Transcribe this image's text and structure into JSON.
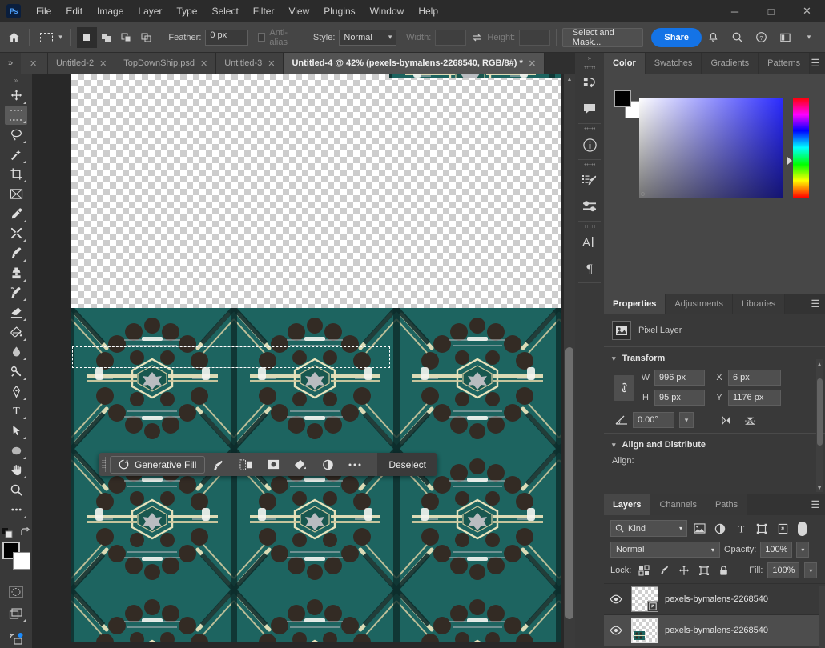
{
  "app": {
    "name": "Adobe Photoshop",
    "logo_text": "Ps"
  },
  "menubar": {
    "items": [
      "File",
      "Edit",
      "Image",
      "Layer",
      "Type",
      "Select",
      "Filter",
      "View",
      "Plugins",
      "Window",
      "Help"
    ]
  },
  "window_controls": {
    "minimize": "─",
    "maximize": "□",
    "close": "✕"
  },
  "options_bar": {
    "home_icon": "home-icon",
    "tool_icon": "rectangular-marquee-icon",
    "selection_modes": [
      "new-selection",
      "add-to-selection",
      "subtract-from-selection",
      "intersect-with-selection"
    ],
    "active_selection_mode": 0,
    "feather_label": "Feather:",
    "feather_value": "0 px",
    "antialias_label": "Anti-alias",
    "antialias_checked": false,
    "style_label": "Style:",
    "style_value": "Normal",
    "width_label": "Width:",
    "width_value": "",
    "height_label": "Height:",
    "height_value": "",
    "swap_icon": "swap-dimensions-icon",
    "select_and_mask": "Select and Mask...",
    "share": "Share",
    "right_icons": [
      "bell-icon",
      "search-icon",
      "help-icon",
      "workspace-icon",
      "chevron-down-icon"
    ]
  },
  "tabs": {
    "overflow_left": "»",
    "overflow_right": "»",
    "items": [
      {
        "label": "",
        "active": false,
        "clipped": true
      },
      {
        "label": "Untitled-2",
        "active": false,
        "clipped": false
      },
      {
        "label": "TopDownShip.psd",
        "active": false,
        "clipped": false
      },
      {
        "label": "Untitled-3",
        "active": false,
        "clipped": false
      },
      {
        "label": "Untitled-4 @ 42% (pexels-bymalens-2268540, RGB/8#) *",
        "active": true,
        "clipped": false
      }
    ],
    "close_glyph": "✕"
  },
  "toolbar": {
    "collapse_glyph": "»",
    "tools": [
      {
        "name": "move-tool",
        "has_flyout": true,
        "active": false
      },
      {
        "name": "rectangular-marquee-tool",
        "has_flyout": true,
        "active": true
      },
      {
        "name": "lasso-tool",
        "has_flyout": true,
        "active": false
      },
      {
        "name": "magic-wand-tool",
        "has_flyout": true,
        "active": false
      },
      {
        "name": "crop-tool",
        "has_flyout": true,
        "active": false
      },
      {
        "name": "frame-tool",
        "has_flyout": false,
        "active": false
      },
      {
        "name": "eyedropper-tool",
        "has_flyout": true,
        "active": false
      },
      {
        "name": "spot-healing-brush-tool",
        "has_flyout": true,
        "active": false
      },
      {
        "name": "brush-tool",
        "has_flyout": true,
        "active": false
      },
      {
        "name": "clone-stamp-tool",
        "has_flyout": true,
        "active": false
      },
      {
        "name": "history-brush-tool",
        "has_flyout": true,
        "active": false
      },
      {
        "name": "eraser-tool",
        "has_flyout": true,
        "active": false
      },
      {
        "name": "gradient-tool",
        "has_flyout": true,
        "active": false
      },
      {
        "name": "blur-tool",
        "has_flyout": true,
        "active": false
      },
      {
        "name": "dodge-tool",
        "has_flyout": true,
        "active": false
      },
      {
        "name": "pen-tool",
        "has_flyout": true,
        "active": false
      },
      {
        "name": "type-tool",
        "has_flyout": true,
        "active": false
      },
      {
        "name": "path-selection-tool",
        "has_flyout": true,
        "active": false
      },
      {
        "name": "ellipse-shape-tool",
        "has_flyout": true,
        "active": false
      },
      {
        "name": "hand-tool",
        "has_flyout": true,
        "active": false
      },
      {
        "name": "zoom-tool",
        "has_flyout": false,
        "active": false
      },
      {
        "name": "edit-toolbar-tool",
        "has_flyout": true,
        "active": false
      }
    ],
    "foreground_color": "#000000",
    "background_color": "#ffffff",
    "default_colors_icon": "default-colors-icon",
    "swap_colors_icon": "swap-colors-icon",
    "quick_mask_icon": "quick-mask-icon",
    "screen_mode_icon": "screen-mode-icon",
    "share_image_icon": "share-image-icon"
  },
  "canvas": {
    "zoom": "42%",
    "document_title": "Untitled-4",
    "selection": {
      "label": "marching-ants-selection"
    },
    "image_name": "pexels-bymalens-2268540",
    "palette": {
      "teal": "#1d6460",
      "dark_teal": "#0d3331",
      "cream": "#e7e2bb",
      "dark_brown": "#332b24",
      "light_gray": "#c8cdd0",
      "white_highlight": "#f4f6f2"
    }
  },
  "contextual_taskbar": {
    "grip": "drag-handle-icon",
    "generative_fill": "Generative Fill",
    "generative_fill_icon": "generative-fill-sparkle-icon",
    "icons": [
      "select-subject-icon",
      "select-and-mask-icon",
      "add-mask-icon",
      "adjustment-fill-icon",
      "adjustment-layer-icon",
      "more-options-icon"
    ],
    "deselect": "Deselect"
  },
  "icon_dock": {
    "collapse_glyph": "»",
    "items": [
      {
        "name": "history-icon"
      },
      {
        "name": "comments-icon"
      },
      {
        "name": "info-icon"
      },
      {
        "name": "brush-settings-icon"
      },
      {
        "name": "adjustments-sliders-icon"
      },
      {
        "name": "character-icon"
      },
      {
        "name": "paragraph-icon"
      }
    ]
  },
  "color_panel": {
    "tabs": [
      "Color",
      "Swatches",
      "Gradients",
      "Patterns"
    ],
    "active_tab": "Color",
    "menu_icon": "panel-menu-icon",
    "foreground": "#000000",
    "background": "#ffffff"
  },
  "properties_panel": {
    "tabs": [
      "Properties",
      "Adjustments",
      "Libraries"
    ],
    "active_tab": "Properties",
    "menu_icon": "panel-menu-icon",
    "layer_type_icon": "pixel-layer-icon",
    "layer_type": "Pixel Layer",
    "transform": {
      "title": "Transform",
      "link_icon": "link-aspect-ratio-icon",
      "w_label": "W",
      "w_value": "996 px",
      "h_label": "H",
      "h_value": "95 px",
      "x_label": "X",
      "x_value": "6 px",
      "y_label": "Y",
      "y_value": "1176 px",
      "angle_icon": "angle-icon",
      "angle_value": "0.00°",
      "flip_horizontal_icon": "flip-horizontal-icon",
      "flip_vertical_icon": "flip-vertical-icon"
    },
    "align": {
      "title": "Align and Distribute",
      "label": "Align:"
    }
  },
  "layers_panel": {
    "tabs": [
      "Layers",
      "Channels",
      "Paths"
    ],
    "active_tab": "Layers",
    "menu_icon": "panel-menu-icon",
    "filter": {
      "search_icon": "search-icon",
      "kind_label": "Kind",
      "filter_icons": [
        "filter-pixel-icon",
        "filter-adjustment-icon",
        "filter-type-icon",
        "filter-shape-icon",
        "filter-smart-object-icon"
      ],
      "toggle": "filter-toggle"
    },
    "blend_mode": "Normal",
    "opacity_label": "Opacity:",
    "opacity_value": "100%",
    "lock_label": "Lock:",
    "lock_icons": [
      "lock-transparent-pixels-icon",
      "lock-image-pixels-icon",
      "lock-position-icon",
      "lock-artboard-icon",
      "lock-all-icon"
    ],
    "fill_label": "Fill:",
    "fill_value": "100%",
    "layers": [
      {
        "name": "pexels-bymalens-2268540",
        "visible": true,
        "selected": false,
        "smart_object": true,
        "eye_icon": "eye-icon"
      },
      {
        "name": "pexels-bymalens-2268540",
        "visible": true,
        "selected": true,
        "smart_object": false,
        "eye_icon": "eye-icon"
      }
    ]
  },
  "theme": {
    "accent_blue": "#1473e6",
    "panel_bg": "#393939",
    "panel_alt": "#474747",
    "titlebar_bg": "#2b2b2b",
    "canvas_bg": "#282828",
    "text": "#c8c8c8"
  }
}
